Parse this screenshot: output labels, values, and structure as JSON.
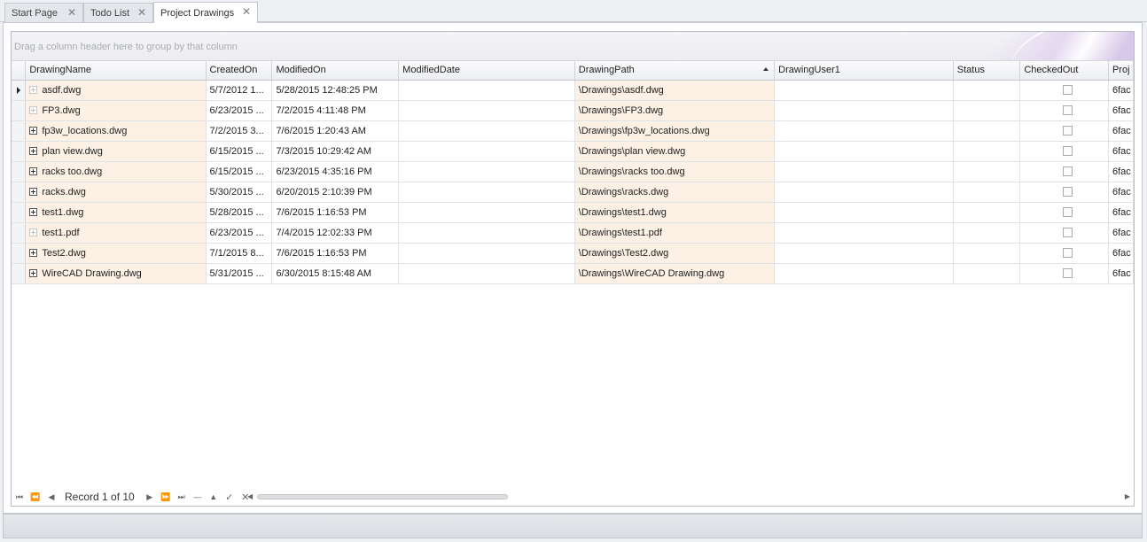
{
  "tabs": [
    {
      "label": "Start Page",
      "active": false
    },
    {
      "label": "Todo List",
      "active": false
    },
    {
      "label": "Project Drawings",
      "active": true
    }
  ],
  "grid": {
    "group_panel_text": "Drag a column header here to group by that column",
    "sorted_column": "DrawingPath",
    "sort_direction": "ascending",
    "columns": [
      "DrawingName",
      "CreatedOn",
      "ModifiedOn",
      "ModifiedDate",
      "DrawingPath",
      "DrawingUser1",
      "Status",
      "CheckedOut",
      "Proj"
    ],
    "rows": [
      {
        "name": "asdf.dwg",
        "expander": "faint",
        "created": "5/7/2012 1...",
        "modified": "5/28/2015 12:48:25 PM",
        "modified_date": "",
        "path": "\\Drawings\\asdf.dwg",
        "user": "",
        "status": "",
        "checked_out": false,
        "proj": "6fac",
        "current": true
      },
      {
        "name": "FP3.dwg",
        "expander": "faint",
        "created": "6/23/2015 ...",
        "modified": "7/2/2015 4:11:48 PM",
        "modified_date": "",
        "path": "\\Drawings\\FP3.dwg",
        "user": "",
        "status": "",
        "checked_out": false,
        "proj": "6fac",
        "current": false
      },
      {
        "name": "fp3w_locations.dwg",
        "expander": "full",
        "created": "7/2/2015 3...",
        "modified": "7/6/2015 1:20:43 AM",
        "modified_date": "",
        "path": "\\Drawings\\fp3w_locations.dwg",
        "user": "",
        "status": "",
        "checked_out": false,
        "proj": "6fac",
        "current": false
      },
      {
        "name": "plan view.dwg",
        "expander": "full",
        "created": "6/15/2015 ...",
        "modified": "7/3/2015 10:29:42 AM",
        "modified_date": "",
        "path": "\\Drawings\\plan view.dwg",
        "user": "",
        "status": "",
        "checked_out": false,
        "proj": "6fac",
        "current": false
      },
      {
        "name": "racks too.dwg",
        "expander": "full",
        "created": "6/15/2015 ...",
        "modified": "6/23/2015 4:35:16 PM",
        "modified_date": "",
        "path": "\\Drawings\\racks too.dwg",
        "user": "",
        "status": "",
        "checked_out": false,
        "proj": "6fac",
        "current": false
      },
      {
        "name": "racks.dwg",
        "expander": "full",
        "created": "5/30/2015 ...",
        "modified": "6/20/2015 2:10:39 PM",
        "modified_date": "",
        "path": "\\Drawings\\racks.dwg",
        "user": "",
        "status": "",
        "checked_out": false,
        "proj": "6fac",
        "current": false
      },
      {
        "name": "test1.dwg",
        "expander": "full",
        "created": "5/28/2015 ...",
        "modified": "7/6/2015 1:16:53 PM",
        "modified_date": "",
        "path": "\\Drawings\\test1.dwg",
        "user": "",
        "status": "",
        "checked_out": false,
        "proj": "6fac",
        "current": false
      },
      {
        "name": "test1.pdf",
        "expander": "faint",
        "created": "6/23/2015 ...",
        "modified": "7/4/2015 12:02:33 PM",
        "modified_date": "",
        "path": "\\Drawings\\test1.pdf",
        "user": "",
        "status": "",
        "checked_out": false,
        "proj": "6fac",
        "current": false
      },
      {
        "name": "Test2.dwg",
        "expander": "full",
        "created": "7/1/2015 8...",
        "modified": "7/6/2015 1:16:53 PM",
        "modified_date": "",
        "path": "\\Drawings\\Test2.dwg",
        "user": "",
        "status": "",
        "checked_out": false,
        "proj": "6fac",
        "current": false
      },
      {
        "name": "WireCAD Drawing.dwg",
        "expander": "full",
        "created": "5/31/2015 ...",
        "modified": "6/30/2015 8:15:48 AM",
        "modified_date": "",
        "path": "\\Drawings\\WireCAD Drawing.dwg",
        "user": "",
        "status": "",
        "checked_out": false,
        "proj": "6fac",
        "current": false
      }
    ]
  },
  "navigator": {
    "record_text": "Record 1 of 10",
    "buttons": [
      "first",
      "prev-page",
      "prev",
      "next",
      "next-page",
      "last",
      "append",
      "delete",
      "end-edit",
      "cancel-edit"
    ]
  },
  "colors": {
    "highlight_column": "#fdf0e5",
    "accent_deco": "#d5c4e8"
  }
}
